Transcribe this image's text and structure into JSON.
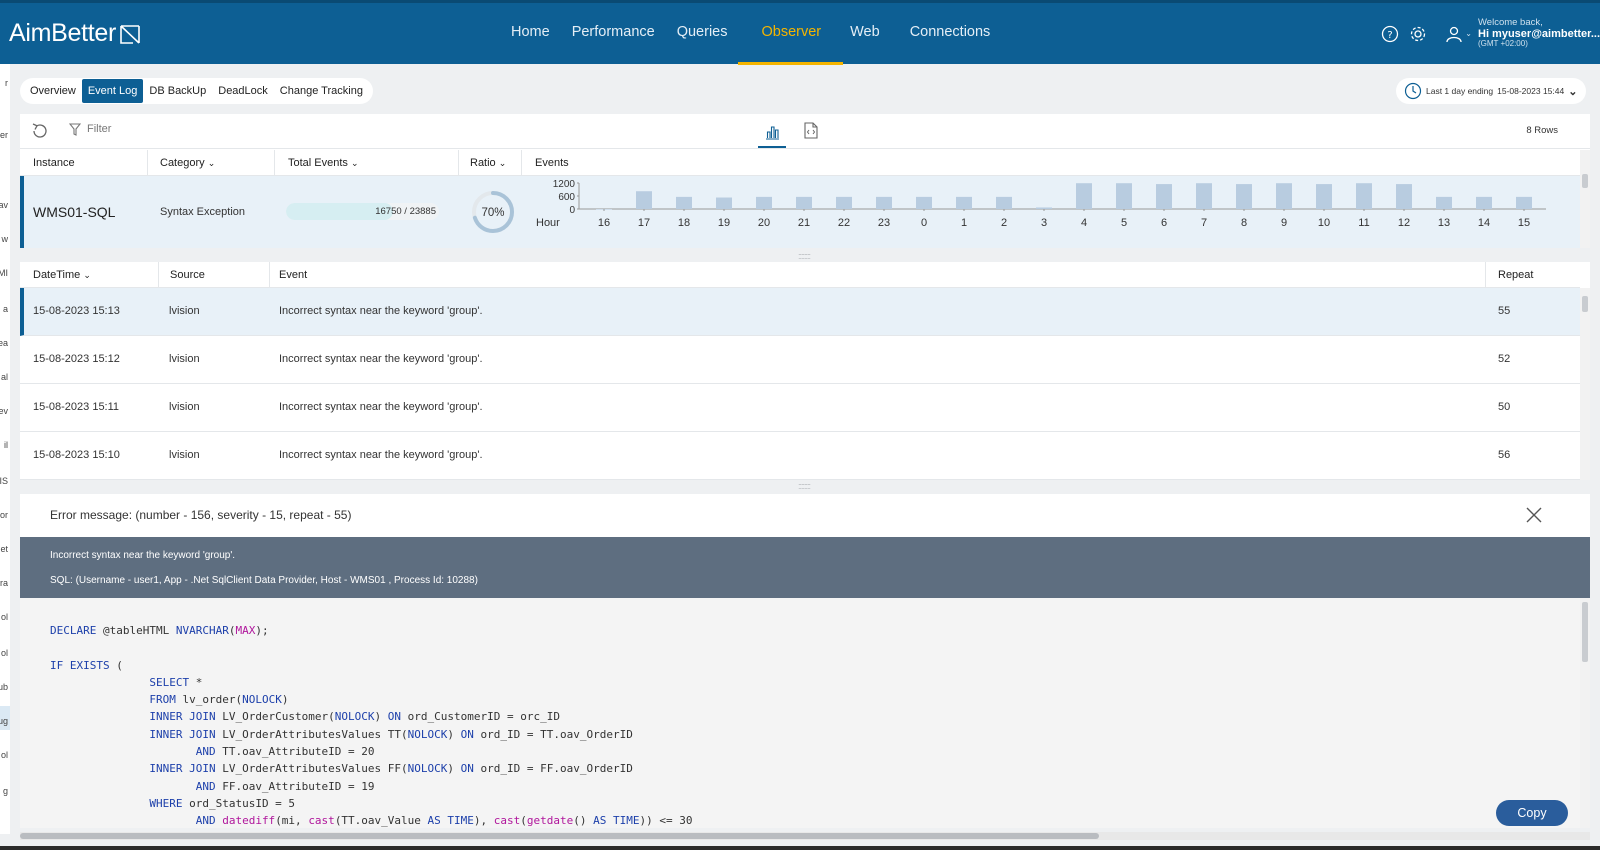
{
  "app": {
    "logo_text": "AimBetter"
  },
  "nav": [
    {
      "label": "Home",
      "active": false
    },
    {
      "label": "Performance",
      "active": false
    },
    {
      "label": "Queries",
      "active": false
    },
    {
      "label": "Observer",
      "active": true
    },
    {
      "label": "Web",
      "active": false
    },
    {
      "label": "Connections",
      "active": false
    }
  ],
  "user": {
    "welcome": "Welcome back,",
    "greeting": "Hi myuser@aimbetter....",
    "timezone": "(GMT +02:00)"
  },
  "left_strip": [
    "r",
    "er",
    "av",
    "w",
    "MI",
    "a",
    "ea",
    "al",
    "ev",
    "il",
    "IS",
    "or",
    "et",
    "ra",
    "ol",
    "ol",
    "ub",
    "ug",
    "ol",
    "g"
  ],
  "subtabs": [
    {
      "label": "Overview",
      "active": false
    },
    {
      "label": "Event Log",
      "active": true
    },
    {
      "label": "DB BackUp",
      "active": false
    },
    {
      "label": "DeadLock",
      "active": false
    },
    {
      "label": "Change Tracking",
      "active": false
    }
  ],
  "date_range": {
    "label": "Last 1 day ending",
    "value": "15-08-2023 15:44"
  },
  "toolbar": {
    "filter_label": "Filter",
    "rows_label": "8 Rows"
  },
  "instances_table": {
    "headers": {
      "instance": "Instance",
      "category": "Category",
      "total_events": "Total Events",
      "ratio": "Ratio",
      "events": "Events"
    },
    "row": {
      "instance": "WMS01-SQL",
      "category": "Syntax Exception",
      "total_events": "16750 / 23885",
      "progress": 0.7,
      "ratio": "70%",
      "ratio_value": 0.7
    }
  },
  "chart_data": {
    "type": "bar",
    "title": "",
    "xlabel": "Hour",
    "ylabel": "",
    "ylim": [
      0,
      1200
    ],
    "yticks": [
      "1200",
      "600",
      "0"
    ],
    "categories": [
      "16",
      "17",
      "18",
      "19",
      "20",
      "21",
      "22",
      "23",
      "0",
      "1",
      "2",
      "3",
      "4",
      "5",
      "6",
      "7",
      "8",
      "9",
      "10",
      "11",
      "12",
      "13",
      "14",
      "15"
    ],
    "values": [
      0,
      820,
      560,
      530,
      560,
      560,
      560,
      560,
      560,
      560,
      560,
      70,
      1190,
      1190,
      1150,
      1190,
      1150,
      1190,
      1150,
      1190,
      1150,
      560,
      560,
      560
    ],
    "bar_color": "#b8cce0"
  },
  "events_table": {
    "headers": {
      "datetime": "DateTime",
      "source": "Source",
      "event": "Event",
      "repeat": "Repeat"
    },
    "rows": [
      {
        "datetime": "15-08-2023 15:13",
        "source": "lvision",
        "event": "Incorrect syntax near the keyword 'group'.",
        "repeat": "55"
      },
      {
        "datetime": "15-08-2023 15:12",
        "source": "lvision",
        "event": "Incorrect syntax near the keyword 'group'.",
        "repeat": "52"
      },
      {
        "datetime": "15-08-2023 15:11",
        "source": "lvision",
        "event": "Incorrect syntax near the keyword 'group'.",
        "repeat": "50"
      },
      {
        "datetime": "15-08-2023 15:10",
        "source": "lvision",
        "event": "Incorrect syntax near the keyword 'group'.",
        "repeat": "56"
      }
    ]
  },
  "error_panel": {
    "title": "Error message: (number - 156, severity - 15, repeat - 55)",
    "message": "Incorrect syntax near the keyword 'group'.",
    "sql_info": "SQL: (Username - user1, App - .Net SqlClient Data Provider, Host - WMS01 , Process Id: 10288)",
    "copy_label": "Copy"
  },
  "colors": {
    "brand": "#0d5f94",
    "accent": "#f4b400",
    "error_bar": "#5e6e80",
    "copy_button": "#2a5d9c"
  }
}
